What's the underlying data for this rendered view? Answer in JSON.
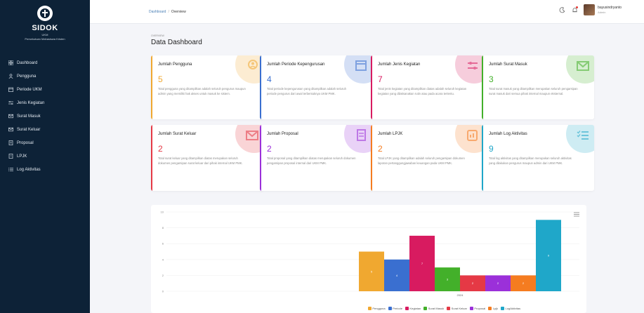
{
  "app": {
    "title": "SIDOK",
    "subtitle": "UKM",
    "org": "Persekutuan Mahasiswa Kristen"
  },
  "sidebar": {
    "items": [
      {
        "label": "Dashboard",
        "icon": "grid-icon"
      },
      {
        "label": "Pengguna",
        "icon": "users-icon"
      },
      {
        "label": "Periode UKM",
        "icon": "calendar-icon"
      },
      {
        "label": "Jenis Kegiatan",
        "icon": "sliders-icon"
      },
      {
        "label": "Surat Masuk",
        "icon": "mail-in-icon"
      },
      {
        "label": "Surat Keluar",
        "icon": "mail-out-icon"
      },
      {
        "label": "Proposal",
        "icon": "document-icon"
      },
      {
        "label": "LPJK",
        "icon": "report-icon"
      },
      {
        "label": "Log Aktivitas",
        "icon": "list-icon"
      }
    ]
  },
  "topbar": {
    "breadcrumb": [
      "Dashboard",
      "Overview"
    ],
    "breadcrumb_sep": "/",
    "user_name": "bayusindryanto",
    "user_role": "Admin"
  },
  "header": {
    "overline": "OVERVIEW",
    "title": "Data Dashboard"
  },
  "cards": [
    {
      "title": "Jumlah Pengguna",
      "value": "5",
      "color": "#f0a830",
      "desc": "Total pengguna yang ditampilkan adalah seluruh pengurus maupun admin yang memiliki hak akses untuk masuk ke sistem."
    },
    {
      "title": "Jumlah Periode Kepengurusan",
      "value": "4",
      "color": "#3a6fd0",
      "desc": "Total periode kepengurusan yang ditampilkan adalah seluruh periode pengurus dari awal terbentuknya UKM PMK."
    },
    {
      "title": "Jumlah Jenis Kegiatan",
      "value": "7",
      "color": "#d81b60",
      "desc": "Total jenis kegiatan yang ditampilkan diatas adalah seluruh kegiatan kegiatan yang dilaksanakan rutin atau pada acara tertentu."
    },
    {
      "title": "Jumlah Surat Masuk",
      "value": "3",
      "color": "#43b02a",
      "desc": "Total surat masuk yang ditampilkan merupakan seluruh pengarsipan surat masuk dari semua pihak internal maupun eksternal."
    },
    {
      "title": "Jumlah Surat Keluar",
      "value": "2",
      "color": "#e53945",
      "desc": "Total surat keluar yang ditampilkan diatas merupakan seluruh dokumen pengarsipan surat keluar dari pihak internal UKM PMK."
    },
    {
      "title": "Jumlah Proposal",
      "value": "2",
      "color": "#9b30d9",
      "desc": "Total proposal yang ditampilkan diatas merupakan seluruh dokumen pengarsipan proposal internal dari UKM PMK."
    },
    {
      "title": "Jumlah LPJK",
      "value": "2",
      "color": "#f57c20",
      "desc": "Total LPJK yang ditampilkan adalah seluruh pengarsipan dokumen laporan pertanggungjawaban keuangan pada UKM PMK."
    },
    {
      "title": "Jumlah Log Aktivitas",
      "value": "9",
      "color": "#1fa7c9",
      "desc": "Total log aktivitas yang ditampilkan merupakan seluruh aktivitas yang dilakukan pengurus maupun admin dari UKM PMK."
    }
  ],
  "chart_data": {
    "type": "bar",
    "categories": [
      "2024"
    ],
    "series": [
      {
        "name": "Pengguna",
        "values": [
          5
        ],
        "color": "#f0a830"
      },
      {
        "name": "Periode",
        "values": [
          4
        ],
        "color": "#3a6fd0"
      },
      {
        "name": "Kegiatan",
        "values": [
          7
        ],
        "color": "#d81b60"
      },
      {
        "name": "Surat Masuk",
        "values": [
          3
        ],
        "color": "#43b02a"
      },
      {
        "name": "Surat Keluar",
        "values": [
          2
        ],
        "color": "#e53945"
      },
      {
        "name": "Proposal",
        "values": [
          2
        ],
        "color": "#9b30d9"
      },
      {
        "name": "Lpjk",
        "values": [
          2
        ],
        "color": "#f57c20"
      },
      {
        "name": "LogAktivitas",
        "values": [
          9
        ],
        "color": "#1fa7c9"
      }
    ],
    "ylim": [
      0,
      10
    ],
    "yticks": [
      0,
      2,
      4,
      6,
      8,
      10
    ],
    "grid": true,
    "legend": "bottom-center"
  }
}
